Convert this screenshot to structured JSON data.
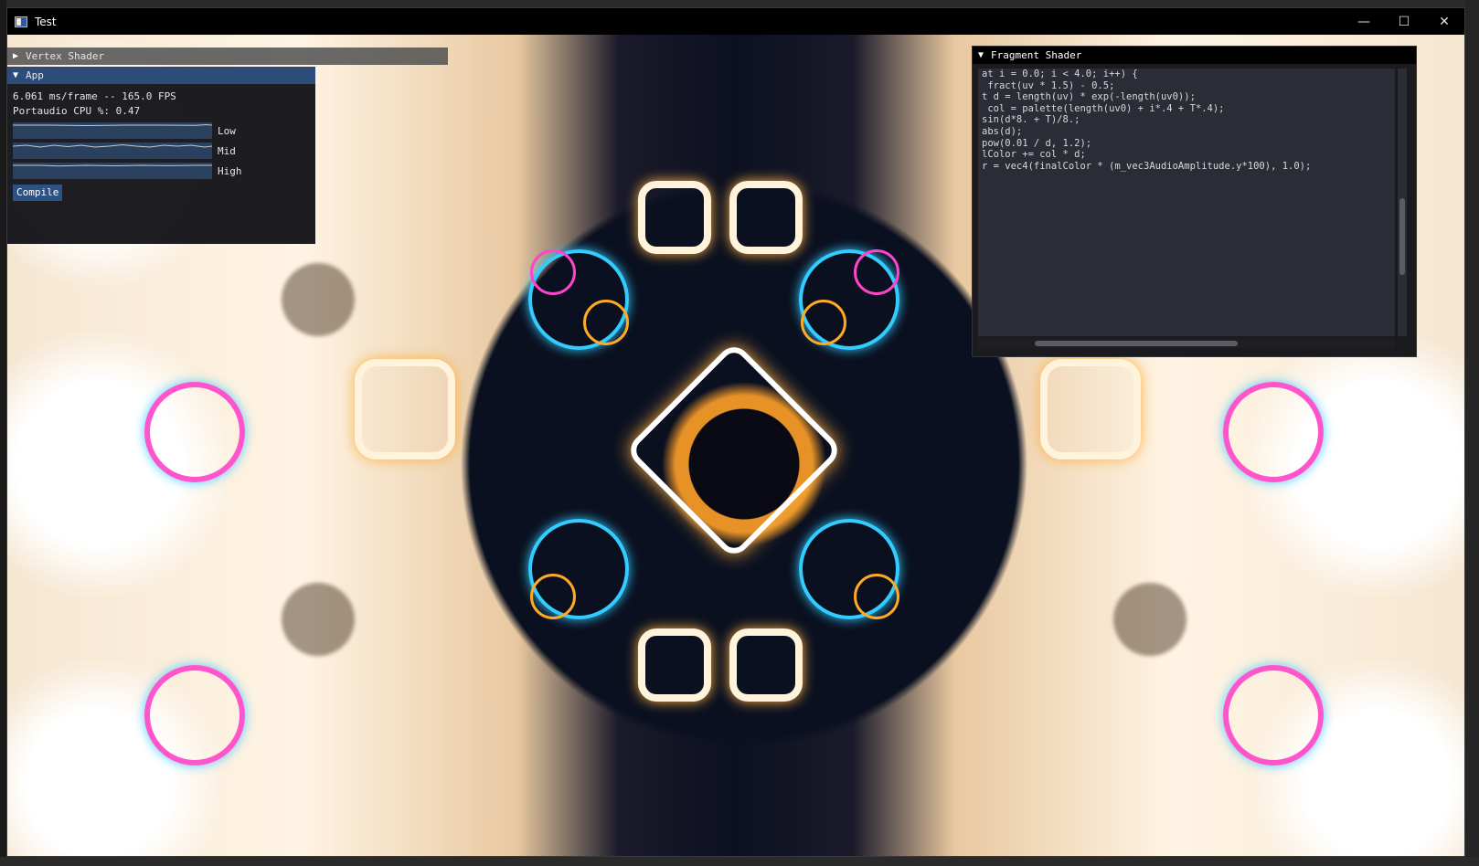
{
  "window": {
    "title": "Test",
    "controls": {
      "minimize": "—",
      "maximize": "☐",
      "close": "✕"
    }
  },
  "vertex_shader": {
    "title": "Vertex Shader",
    "collapsed": true
  },
  "app": {
    "title": "App",
    "frame_stats": "6.061 ms/frame -- 165.0 FPS",
    "cpu_stats": "Portaudio CPU %: 0.47",
    "plots": [
      {
        "label": "Low"
      },
      {
        "label": "Mid"
      },
      {
        "label": "High"
      }
    ],
    "compile_label": "Compile"
  },
  "fragment_shader": {
    "title": "Fragment Shader",
    "code_lines": [
      "at i = 0.0; i < 4.0; i++) {",
      " fract(uv * 1.5) - 0.5;",
      "",
      "t d = length(uv) * exp(-length(uv0));",
      "",
      " col = palette(length(uv0) + i*.4 + T*.4);",
      "",
      "sin(d*8. + T)/8.;",
      "abs(d);",
      "",
      "pow(0.01 / d, 1.2);",
      "",
      "lColor += col * d;",
      "",
      "",
      "r = vec4(finalColor * (m_vec3AudioAmplitude.y*100), 1.0);"
    ]
  },
  "colors": {
    "accent": "#2d4c7a",
    "button": "#2c5283",
    "plot_bg": "#29405e"
  },
  "icons": {
    "collapsed": "triangle-right-icon",
    "expanded": "triangle-down-icon"
  }
}
